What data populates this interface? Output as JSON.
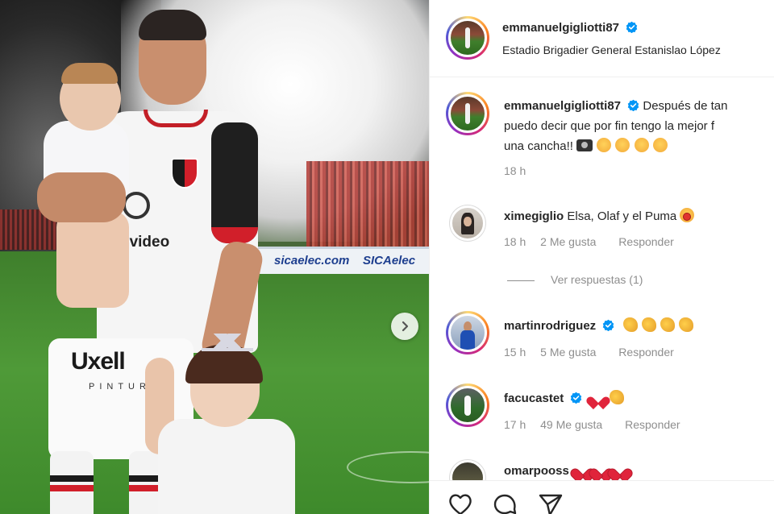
{
  "post": {
    "next_button_label": "Next",
    "photo": {
      "board_text_1": "sicaelec.com",
      "board_text_2": "SICAelec",
      "sponsor_1": "evideo",
      "sponsor_2": "Uxell",
      "sponsor_3": "PINTURAS"
    }
  },
  "header": {
    "username": "emmanuelgigliotti87",
    "location": "Estadio Brigadier General Estanislao López"
  },
  "caption": {
    "username": "emmanuelgigliotti87",
    "text_line1": "Después de tan",
    "text_line2": "puedo decir que por fin tengo la mejor f",
    "text_line3": "una cancha!!",
    "time": "18 h"
  },
  "comments": [
    {
      "username": "ximegiglio",
      "text": "Elsa, Olaf y el Puma",
      "time": "18 h",
      "likes": "2 Me gusta",
      "reply": "Responder",
      "verified": false
    },
    {
      "username": "martinrodriguez",
      "text": "",
      "time": "15 h",
      "likes": "5 Me gusta",
      "reply": "Responder",
      "verified": true
    },
    {
      "username": "facucastet",
      "text": "",
      "time": "17 h",
      "likes": "49 Me gusta",
      "reply": "Responder",
      "verified": true
    },
    {
      "username": "omarpooss",
      "text": "",
      "verified": false
    }
  ],
  "view_replies": "Ver respuestas (1)",
  "colors": {
    "verified": "#0095f6",
    "meta_text": "#8e8e8e",
    "primary_text": "#262626"
  },
  "icons": {
    "verified": "verified-badge-icon",
    "like": "heart-outline-icon",
    "comment": "comment-bubble-icon",
    "share": "paper-plane-icon",
    "next": "chevron-right-icon"
  }
}
